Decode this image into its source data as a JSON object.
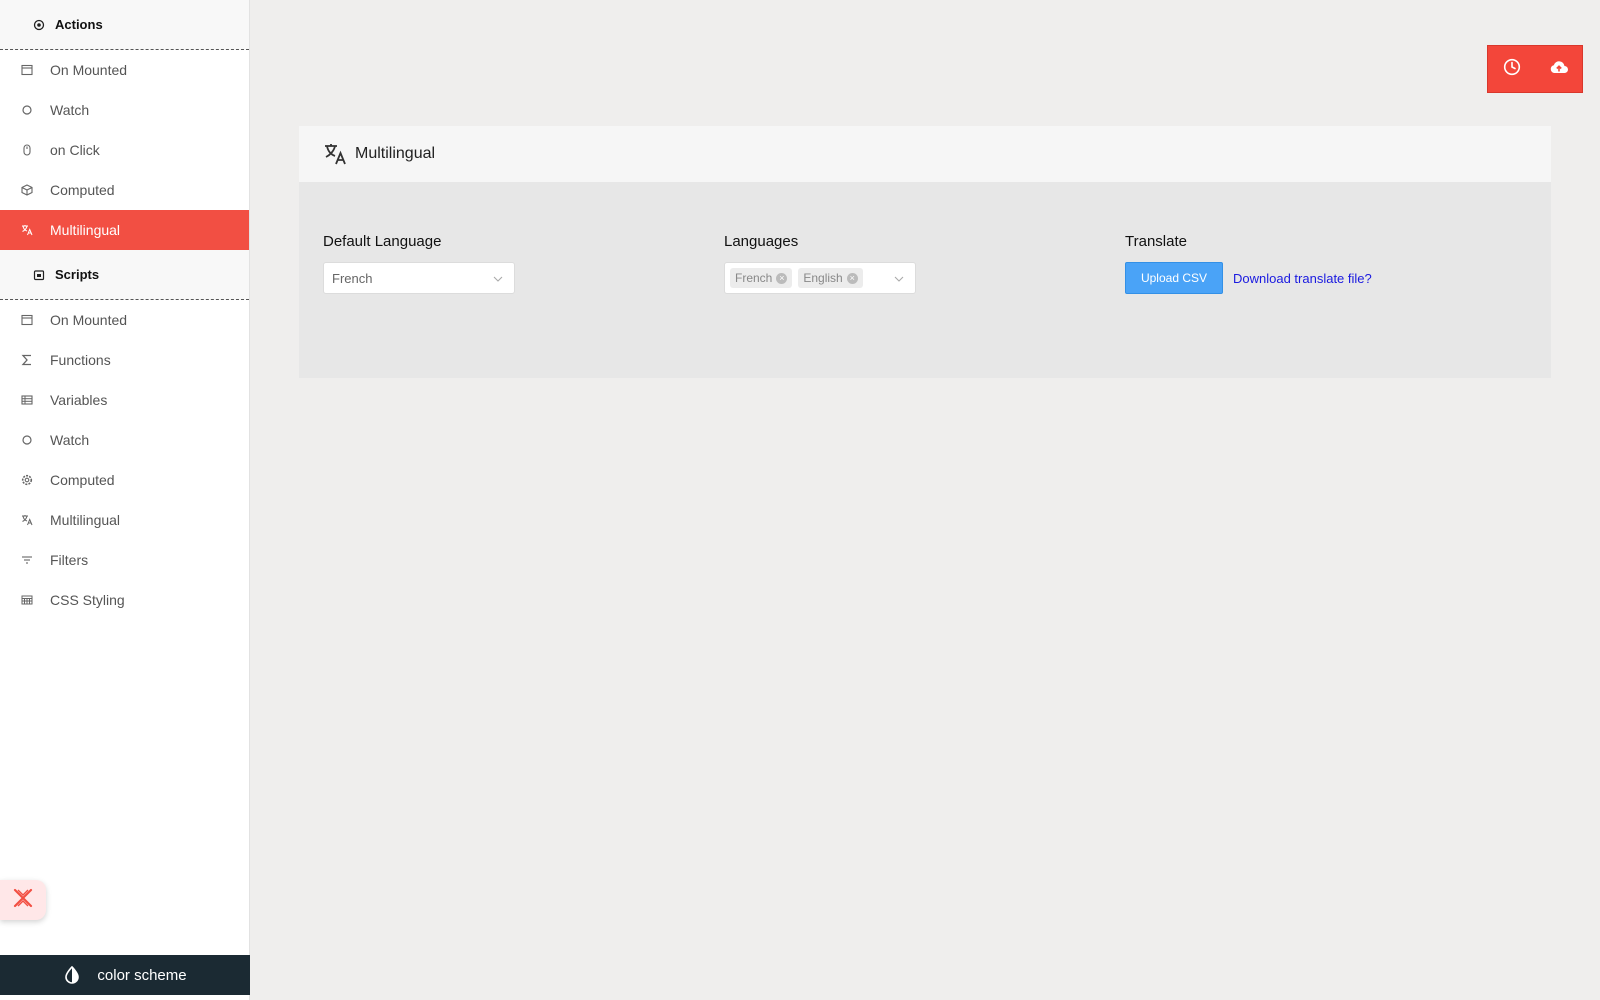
{
  "sidebar": {
    "actions_header": {
      "label": "Actions",
      "icon": "target-icon"
    },
    "actions_items": [
      {
        "label": "On Mounted",
        "icon": "window-icon"
      },
      {
        "label": "Watch",
        "icon": "circle-icon"
      },
      {
        "label": "on Click",
        "icon": "mouse-icon"
      },
      {
        "label": "Computed",
        "icon": "cube-icon"
      },
      {
        "label": "Multilingual",
        "icon": "translate-icon",
        "active": true
      }
    ],
    "scripts_header": {
      "label": "Scripts",
      "icon": "calendar-icon"
    },
    "scripts_items": [
      {
        "label": "On Mounted",
        "icon": "window-icon"
      },
      {
        "label": "Functions",
        "icon": "sigma-icon"
      },
      {
        "label": "Variables",
        "icon": "list-icon"
      },
      {
        "label": "Watch",
        "icon": "circle-icon"
      },
      {
        "label": "Computed",
        "icon": "cog-icon"
      },
      {
        "label": "Multilingual",
        "icon": "translate-icon"
      },
      {
        "label": "Filters",
        "icon": "filter-icon"
      },
      {
        "label": "CSS Styling",
        "icon": "css-icon"
      }
    ],
    "color_scheme_label": "color scheme"
  },
  "panel": {
    "title": "Multilingual",
    "default_language": {
      "label": "Default Language",
      "value": "French"
    },
    "languages": {
      "label": "Languages",
      "tags": [
        "French",
        "English"
      ]
    },
    "translate": {
      "label": "Translate",
      "upload_label": "Upload CSV",
      "download_label": "Download translate file?"
    }
  },
  "colors": {
    "accent": "#f24f43",
    "upload": "#4aa3f7",
    "link": "#1a1ae0",
    "footer": "#1b2a33"
  }
}
